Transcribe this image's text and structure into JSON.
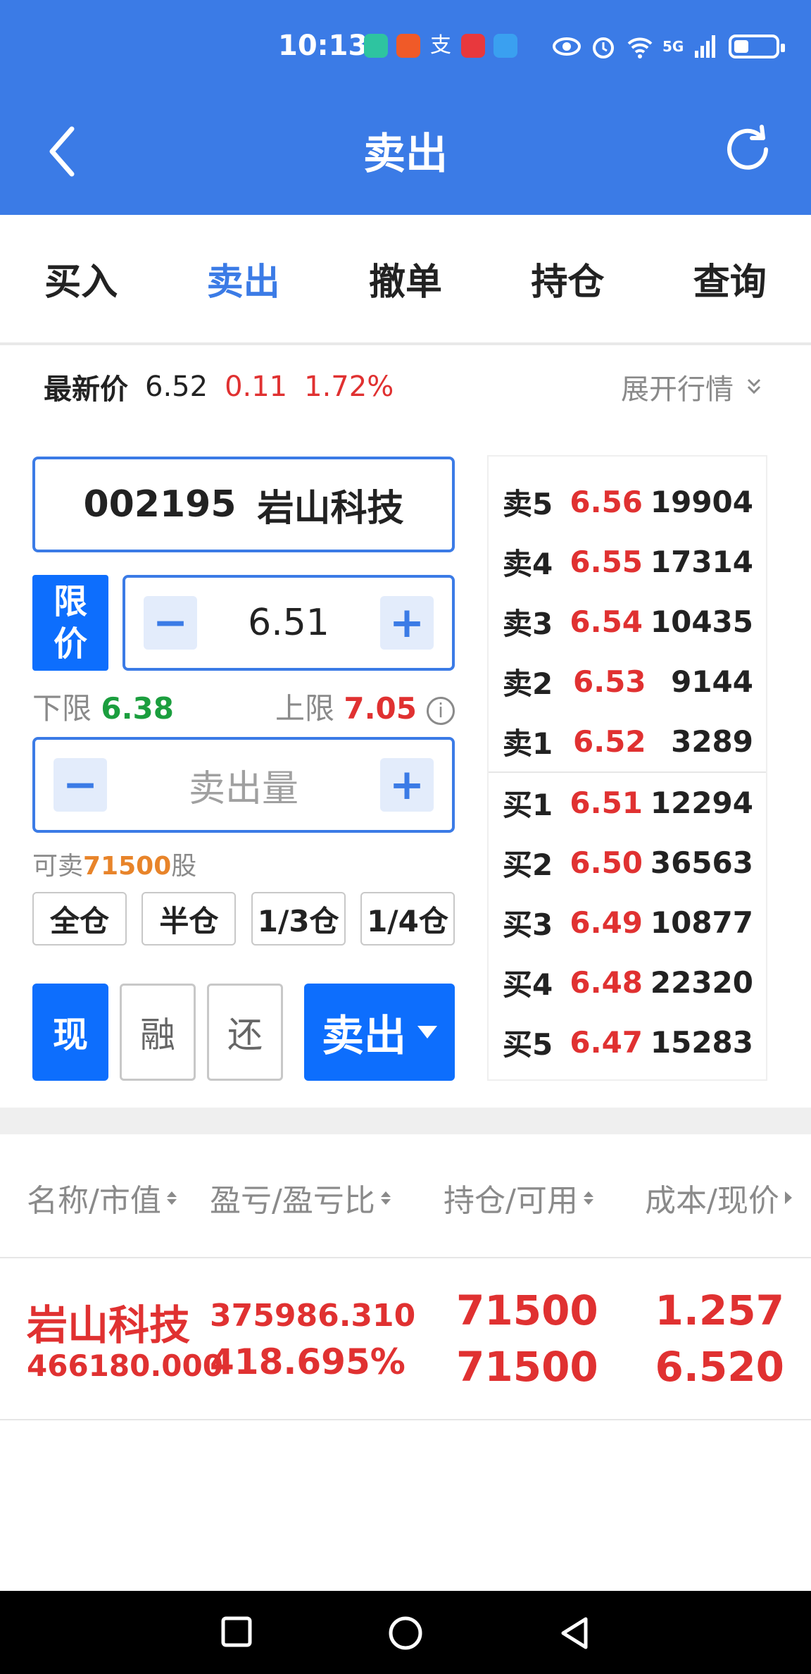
{
  "status": {
    "time": "10:13",
    "network": "5G"
  },
  "nav": {
    "title": "卖出"
  },
  "tabs": [
    {
      "label": "买入"
    },
    {
      "label": "卖出"
    },
    {
      "label": "撤单"
    },
    {
      "label": "持仓"
    },
    {
      "label": "查询"
    }
  ],
  "latest": {
    "label": "最新价",
    "price": "6.52",
    "change": "0.11",
    "change_pct": "1.72%",
    "expand_label": "展开行情"
  },
  "stock": {
    "code": "002195",
    "name": "岩山科技"
  },
  "order": {
    "price_type": "限价",
    "price": "6.51",
    "lower_label": "下限",
    "lower": "6.38",
    "upper_label": "上限",
    "upper": "7.05",
    "qty_placeholder": "卖出量",
    "sellable_prefix": "可卖",
    "sellable_amount": "71500",
    "sellable_suffix": "股",
    "ratios": [
      "全仓",
      "半仓",
      "1/3仓",
      "1/4仓"
    ],
    "types": [
      "现",
      "融",
      "还"
    ],
    "submit_label": "卖出"
  },
  "book": {
    "asks": [
      {
        "label": "卖5",
        "price": "6.56",
        "vol": "19904"
      },
      {
        "label": "卖4",
        "price": "6.55",
        "vol": "17314"
      },
      {
        "label": "卖3",
        "price": "6.54",
        "vol": "10435"
      },
      {
        "label": "卖2",
        "price": "6.53",
        "vol": "9144"
      },
      {
        "label": "卖1",
        "price": "6.52",
        "vol": "3289"
      }
    ],
    "bids": [
      {
        "label": "买1",
        "price": "6.51",
        "vol": "12294"
      },
      {
        "label": "买2",
        "price": "6.50",
        "vol": "36563"
      },
      {
        "label": "买3",
        "price": "6.49",
        "vol": "10877"
      },
      {
        "label": "买4",
        "price": "6.48",
        "vol": "22320"
      },
      {
        "label": "买5",
        "price": "6.47",
        "vol": "15283"
      }
    ]
  },
  "positions": {
    "headers": [
      "名称/市值",
      "盈亏/盈亏比",
      "持仓/可用",
      "成本/现价"
    ],
    "rows": [
      {
        "name": "岩山科技",
        "market_value": "466180.000",
        "pnl": "375986.310",
        "pnl_pct": "418.695%",
        "holding": "71500",
        "available": "71500",
        "cost": "1.257",
        "current": "6.520"
      }
    ]
  },
  "colors": {
    "brand": "#3b7be6",
    "up": "#e03131",
    "down": "#1b9e3e",
    "accent_orange": "#e8842a"
  }
}
